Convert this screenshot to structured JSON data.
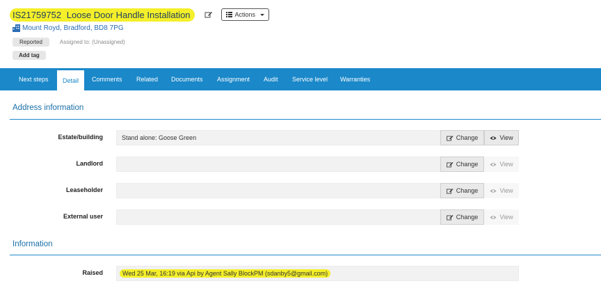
{
  "header": {
    "ref": "IS21759752",
    "title": "Loose Door Handle Installation",
    "actions_label": "Actions",
    "location": "Mount Royd, Bradford, BD8 7PG",
    "status": "Reported",
    "assigned": "Assigned to: (Unassigned)",
    "add_tag": "Add tag"
  },
  "tabs": [
    "Next steps",
    "Detail",
    "Comments",
    "Related",
    "Documents",
    "Assignment",
    "Audit",
    "Service level",
    "Warranties"
  ],
  "active_tab": "Detail",
  "address_section": {
    "title": "Address information",
    "rows": [
      {
        "label": "Estate/building",
        "value": "Stand alone: Goose Green",
        "change": "Change",
        "view": "View",
        "view_enabled": true
      },
      {
        "label": "Landlord",
        "value": "",
        "change": "Change",
        "view": "View",
        "view_enabled": false
      },
      {
        "label": "Leaseholder",
        "value": "",
        "change": "Change",
        "view": "View",
        "view_enabled": false
      },
      {
        "label": "External user",
        "value": "",
        "change": "Change",
        "view": "View",
        "view_enabled": false
      }
    ]
  },
  "info_section": {
    "title": "Information",
    "raised_label": "Raised",
    "raised_value": "Wed 25 Mar, 16:19 via Api by Agent Sally BlockPM (sdanby5@gmail.com)"
  },
  "colors": {
    "tab_bar": "#1a88c9",
    "highlight": "#f4ef2a",
    "section_title": "#1a6fa8"
  },
  "icons": [
    "pencil-icon",
    "list-icon",
    "building-icon",
    "eye-icon"
  ]
}
